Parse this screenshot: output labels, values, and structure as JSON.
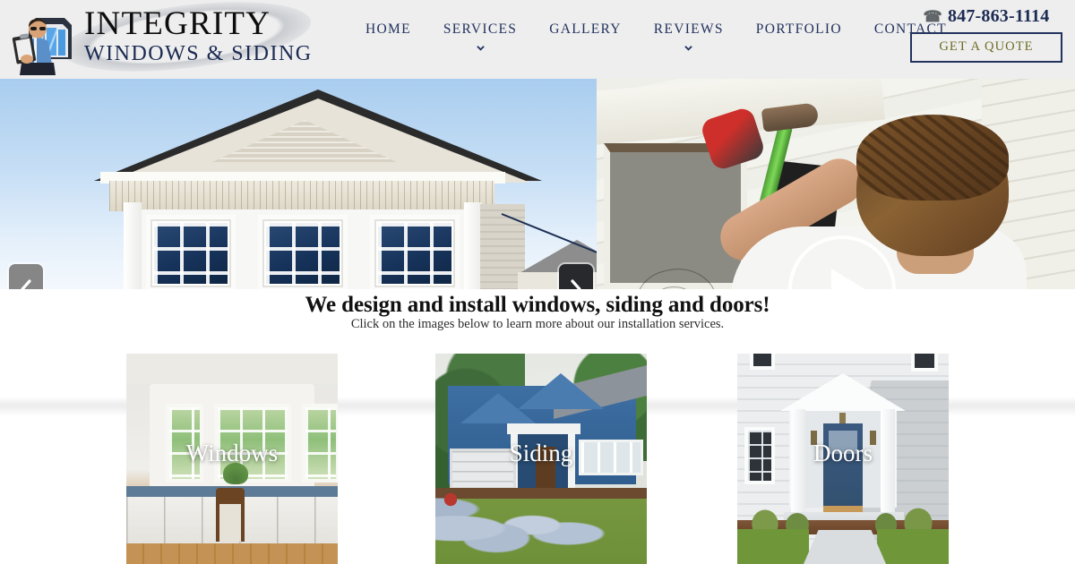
{
  "header": {
    "logo": {
      "title": "INTEGRITY",
      "subtitle": "WINDOWS & SIDING",
      "mascot_icon": "contractor-with-clipboard-icon",
      "window_icon": "bay-window-icon"
    },
    "nav": [
      {
        "label": "HOME",
        "has_dropdown": false
      },
      {
        "label": "SERVICES",
        "has_dropdown": true
      },
      {
        "label": "GALLERY",
        "has_dropdown": false
      },
      {
        "label": "REVIEWS",
        "has_dropdown": true
      },
      {
        "label": "PORTFOLIO",
        "has_dropdown": false
      },
      {
        "label": "CONTACT",
        "has_dropdown": false
      }
    ],
    "phone": "847-863-1114",
    "phone_icon": "telephone-icon",
    "quote_button": "GET A QUOTE"
  },
  "hero": {
    "prev_arrow_icon": "chevron-left-icon",
    "next_arrow_icon": "chevron-right-icon",
    "play_icon": "play-triangle-icon",
    "left_slide_alt": "house-gable-with-windows",
    "right_slide_alt": "worker-installing-window-video"
  },
  "main": {
    "headline": "We design and install windows, siding and doors!",
    "subhead": "Click on the images below to learn more about our installation services.",
    "cards": [
      {
        "label": "Windows",
        "alt": "kitchen-bay-window"
      },
      {
        "label": "Siding",
        "alt": "blue-house-with-siding"
      },
      {
        "label": "Doors",
        "alt": "white-house-with-blue-front-door"
      }
    ]
  },
  "colors": {
    "header_bg": "#eeeeee",
    "navy": "#22325e",
    "olive": "#6e6b22",
    "logo_black": "#0d0d0d"
  }
}
